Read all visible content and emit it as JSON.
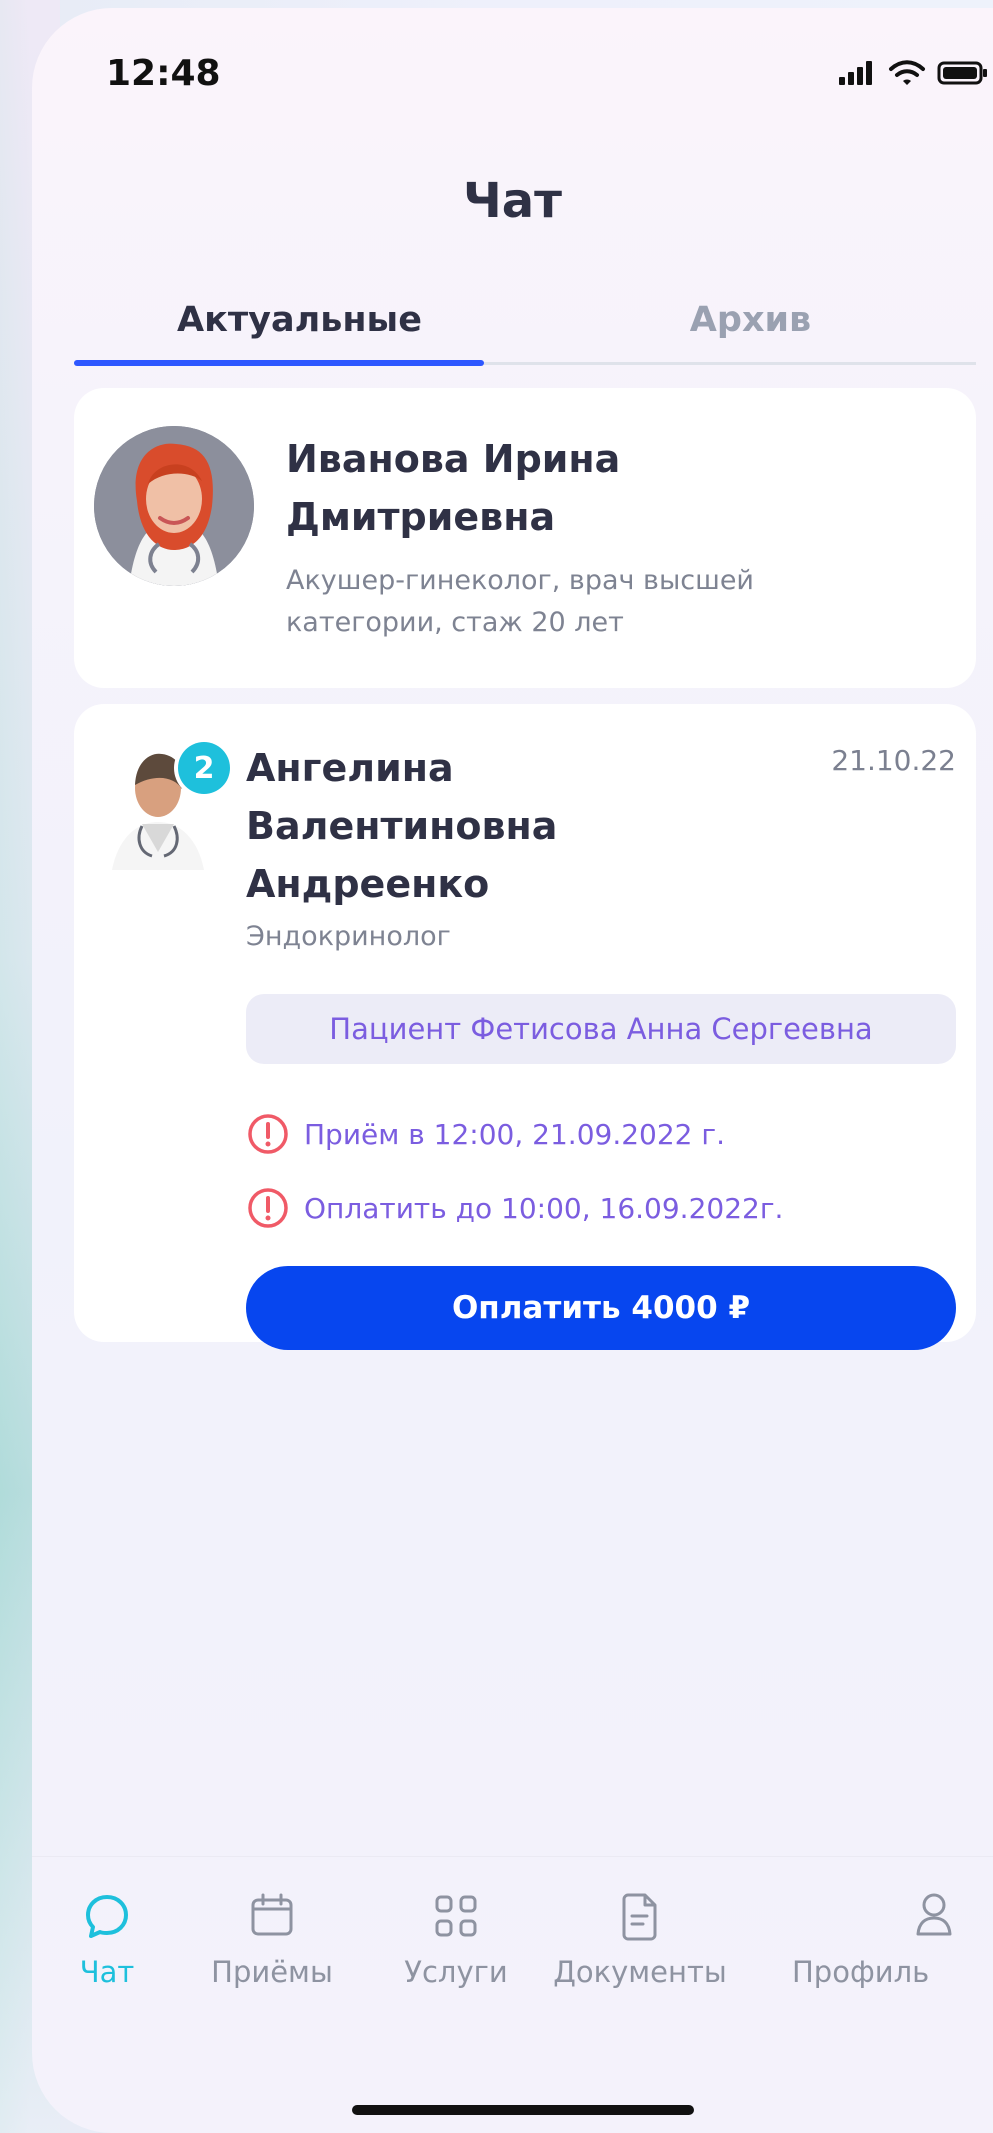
{
  "status_bar": {
    "time": "12:48"
  },
  "header": {
    "title": "Чат"
  },
  "tabs": [
    {
      "label": "Актуальные",
      "active": true
    },
    {
      "label": "Архив",
      "active": false
    }
  ],
  "chat_cards": [
    {
      "doctor_name_line1": "Иванова Ирина",
      "doctor_name_line2": "Дмитриевна",
      "description_line1": "Акушер-гинеколог, врач высшей",
      "description_line2": "категории, стаж 20 лет"
    },
    {
      "badge": "2",
      "doctor_name_line1": "Ангелина",
      "doctor_name_line2": "Валентиновна",
      "doctor_name_line3": "Андреенко",
      "specialty": "Эндокринолог",
      "date": "21.10.22",
      "patient": "Пациент Фетисова Анна Сергеевна",
      "warnings": [
        "Приём в 12:00, 21.09.2022 г.",
        "Оплатить до 10:00, 16.09.2022г."
      ],
      "pay_button": "Оплатить 4000 ₽"
    }
  ],
  "bottom_nav": [
    {
      "label": "Чат",
      "icon": "chat-icon",
      "active": true
    },
    {
      "label": "Приёмы",
      "icon": "calendar-icon",
      "active": false
    },
    {
      "label": "Услуги",
      "icon": "grid-icon",
      "active": false
    },
    {
      "label": "Документы",
      "icon": "document-icon",
      "active": false
    },
    {
      "label": "Профиль",
      "icon": "profile-icon",
      "active": false
    }
  ],
  "colors": {
    "accent": "#0746ef",
    "active_tab": "#2e57ff",
    "badge": "#1ec0dc",
    "warning": "#f05a67",
    "patient_text": "#7b5de0"
  }
}
